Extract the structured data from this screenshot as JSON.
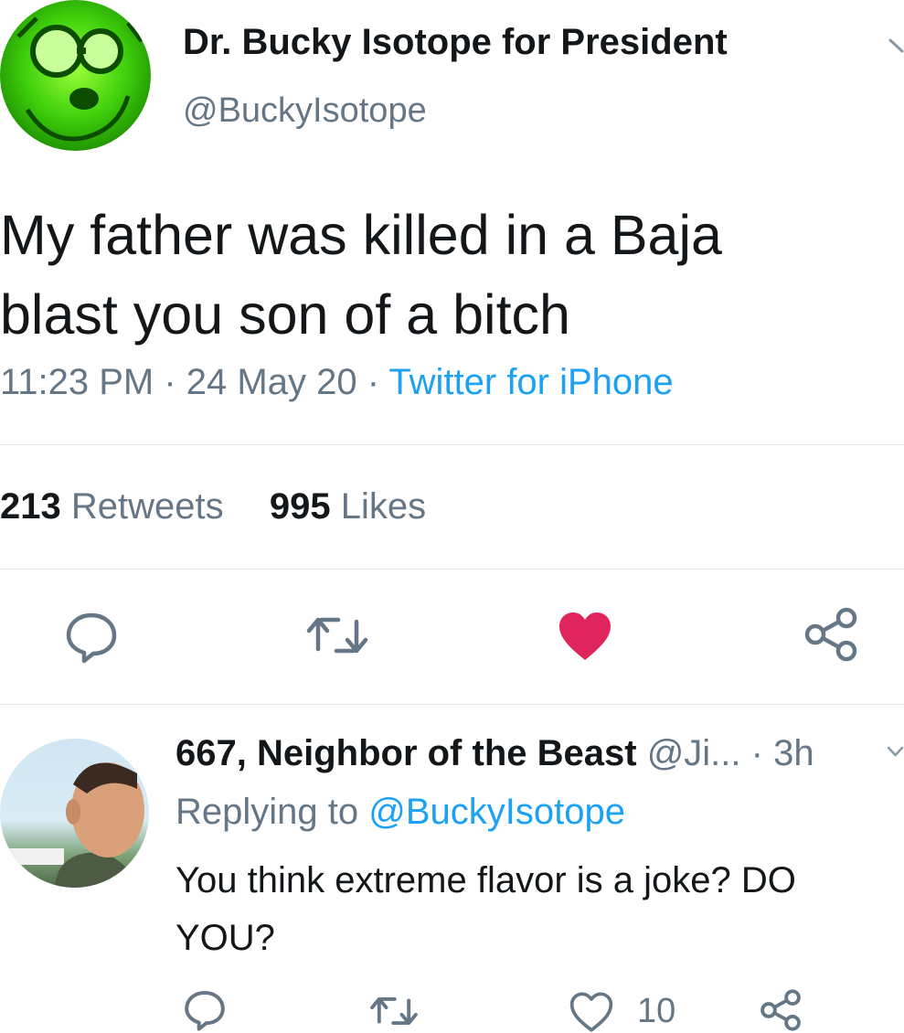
{
  "tweet": {
    "display_name": "Dr. Bucky Isotope for President",
    "handle": "@BuckyIsotope",
    "text": "My father was killed in a Baja blast you son of a bitch",
    "time": "11:23 PM",
    "date": "24 May 20",
    "separator": " · ",
    "source": "Twitter for iPhone",
    "retweets_count": "213",
    "retweets_label": "Retweets",
    "likes_count": "995",
    "likes_label": "Likes",
    "liked": true,
    "like_color": "#e0245e"
  },
  "reply": {
    "display_name": "667, Neighbor of the Beast",
    "handle": "@Ji...",
    "separator": " · ",
    "age": "3h",
    "replying_prefix": "Replying to",
    "replying_to": "@BuckyIsotope",
    "text": "You think extreme flavor is a joke? DO YOU?",
    "like_count": "10"
  },
  "colors": {
    "link": "#1da1f2",
    "secondary_text": "#657786",
    "divider": "#e1e8ed",
    "avatar_green": "#3fd10c"
  },
  "icons": [
    "reply-icon",
    "retweet-icon",
    "like-icon",
    "share-icon",
    "chevron-down-icon"
  ]
}
